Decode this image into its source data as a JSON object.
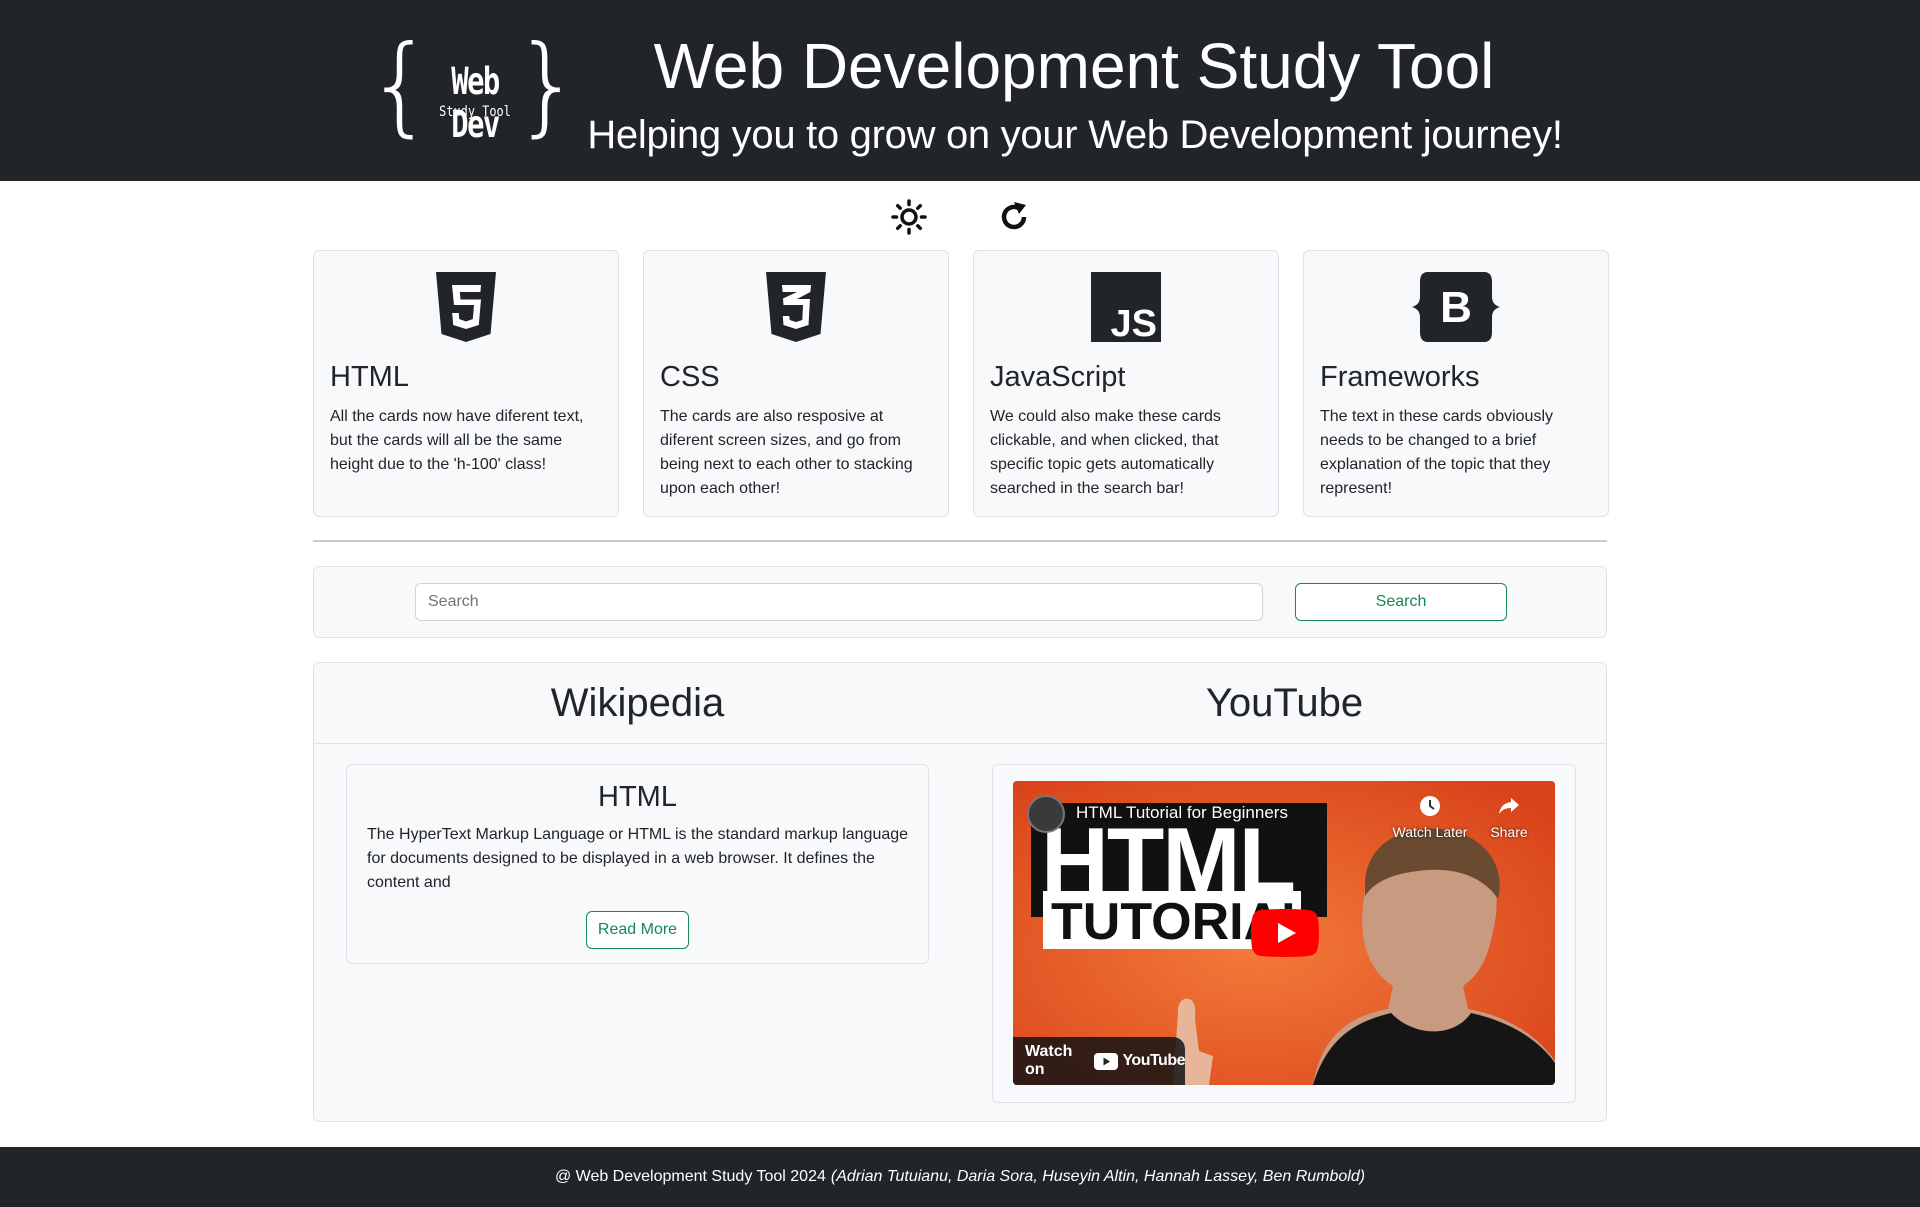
{
  "header": {
    "logo_line1": "Web Dev",
    "logo_line2": "Study Tool",
    "title": "Web Development Study Tool",
    "subtitle": "Helping you to grow on your Web Development journey!"
  },
  "toolbar": {
    "theme_icon": "sun-icon",
    "reload_icon": "reload-icon"
  },
  "cards": [
    {
      "icon": "html5-icon",
      "title": "HTML",
      "text": "All the cards now have diferent text, but the cards will all be the same height due to the 'h-100' class!"
    },
    {
      "icon": "css3-icon",
      "title": "CSS",
      "text": "The cards are also resposive at diferent screen sizes, and go from being next to each other to stacking upon each other!"
    },
    {
      "icon": "javascript-icon",
      "title": "JavaScript",
      "text": "We could also make these cards clickable, and when clicked, that specific topic gets automatically searched in the search bar!"
    },
    {
      "icon": "bootstrap-icon",
      "title": "Frameworks",
      "text": "The text in these cards obviously needs to be changed to a brief explanation of the topic that they represent!"
    }
  ],
  "search": {
    "placeholder": "Search",
    "value": "",
    "button_label": "Search"
  },
  "results": {
    "wikipedia_heading": "Wikipedia",
    "youtube_heading": "YouTube",
    "wiki": {
      "title": "HTML",
      "excerpt": "The HyperText Markup Language or HTML is the standard markup language for documents designed to be displayed in a web browser. It defines the content and",
      "read_more": "Read More"
    },
    "video": {
      "title": "HTML Tutorial for Beginners",
      "thumb_word1": "HTML",
      "thumb_word2": "TUTORIAL",
      "watch_later": "Watch Later",
      "share": "Share",
      "watch_on": "Watch on",
      "youtube_logo": "YouTube"
    }
  },
  "footer": {
    "copyright": "@ Web Development Study Tool 2024",
    "authors": "(Adrian Tutuianu, Daria Sora, Huseyin Altin, Hannah Lassey, Ben Rumbold)"
  },
  "colors": {
    "dark": "#212529",
    "success": "#198754",
    "light_bg": "#f8f9fa",
    "youtube_red": "#ff0000"
  }
}
